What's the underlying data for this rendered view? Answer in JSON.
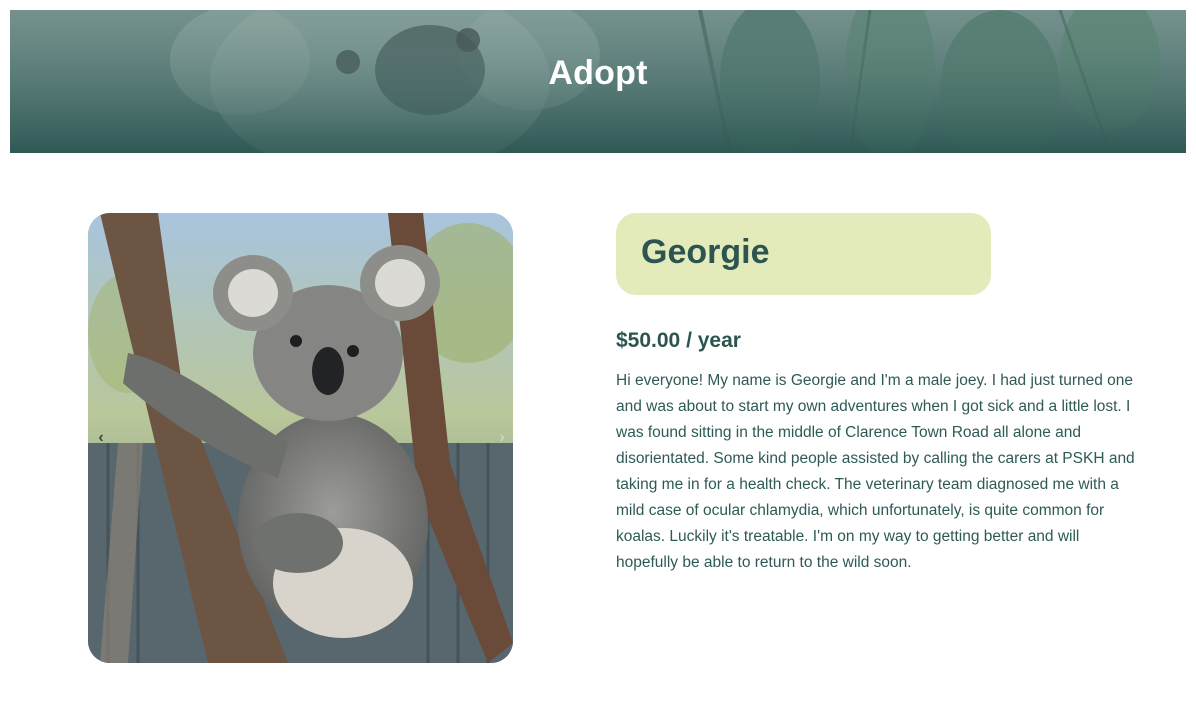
{
  "hero": {
    "title": "Adopt"
  },
  "animal": {
    "name": "Georgie",
    "price": "$50.00 / year",
    "description": "Hi everyone! My name is Georgie and I'm a male joey. I had just turned one and was about to start my own adventures when I got sick and a little lost. I was found sitting in the middle of Clarence Town Road all alone and disorientated. Some kind people assisted by calling the carers at PSKH and taking me in for a health check. The veterinary team diagnosed me with a mild case of ocular chlamydia, which unfortunately, is quite common for koalas. Luckily it's treatable. I'm on my way to getting better and will hopefully be able to return to the wild soon."
  },
  "carousel": {
    "prev_label": "‹",
    "next_label": "›"
  },
  "icons": {
    "prev": "chevron-left-icon",
    "next": "chevron-right-icon"
  },
  "colors": {
    "accent": "#2c5450",
    "name_box_bg": "#e4ebba",
    "hero_overlay": "#4f7470"
  }
}
